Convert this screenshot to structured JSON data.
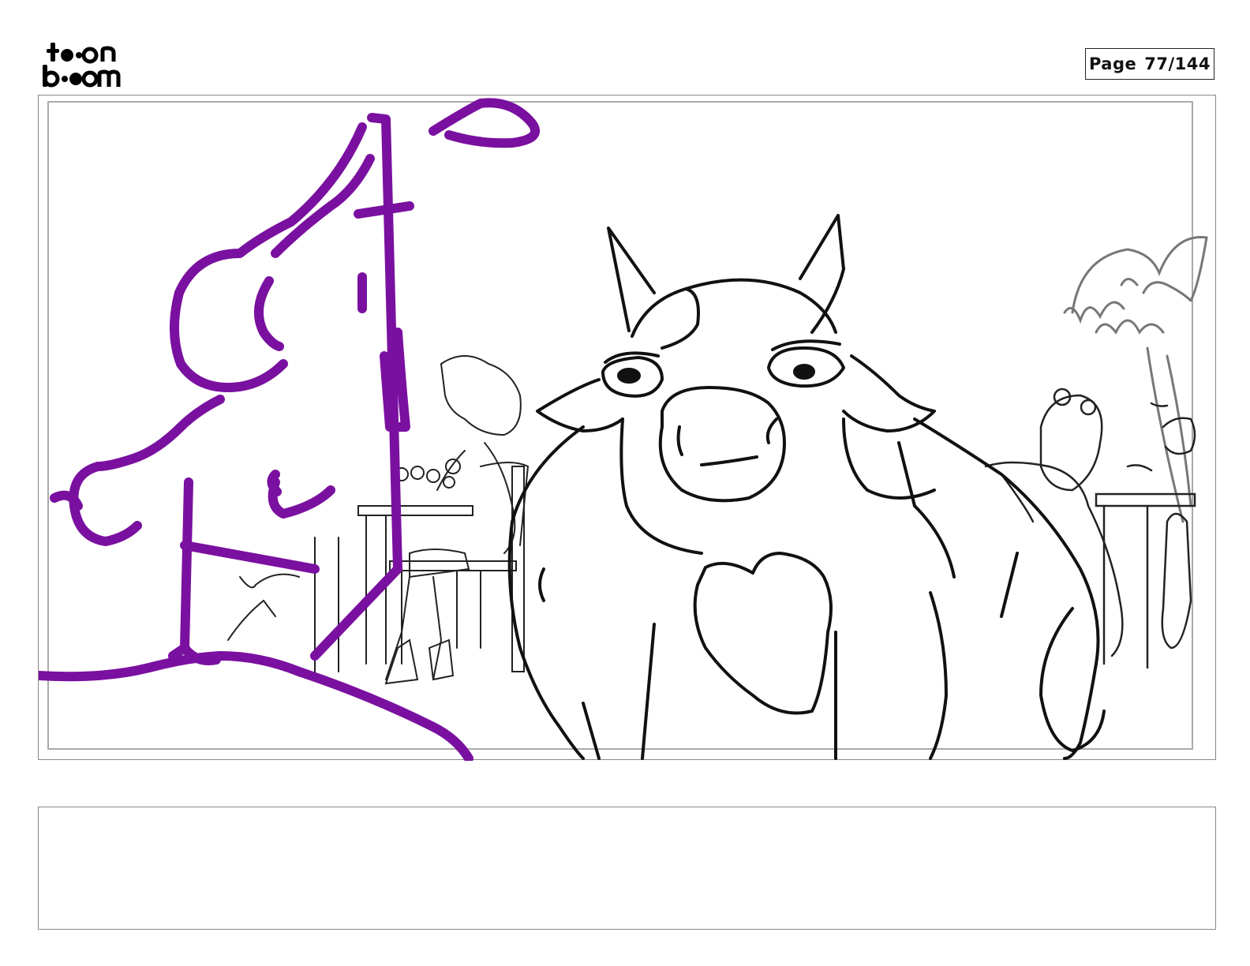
{
  "header": {
    "logo_text_top": "toon",
    "logo_text_bottom": "boom",
    "page_label": "Page",
    "page_number": "77/144"
  },
  "panel": {
    "ink_color_foreground": "#7a10a0",
    "ink_color_lines": "#111111",
    "ink_color_background": "#777777"
  },
  "notes": {
    "text": ""
  }
}
